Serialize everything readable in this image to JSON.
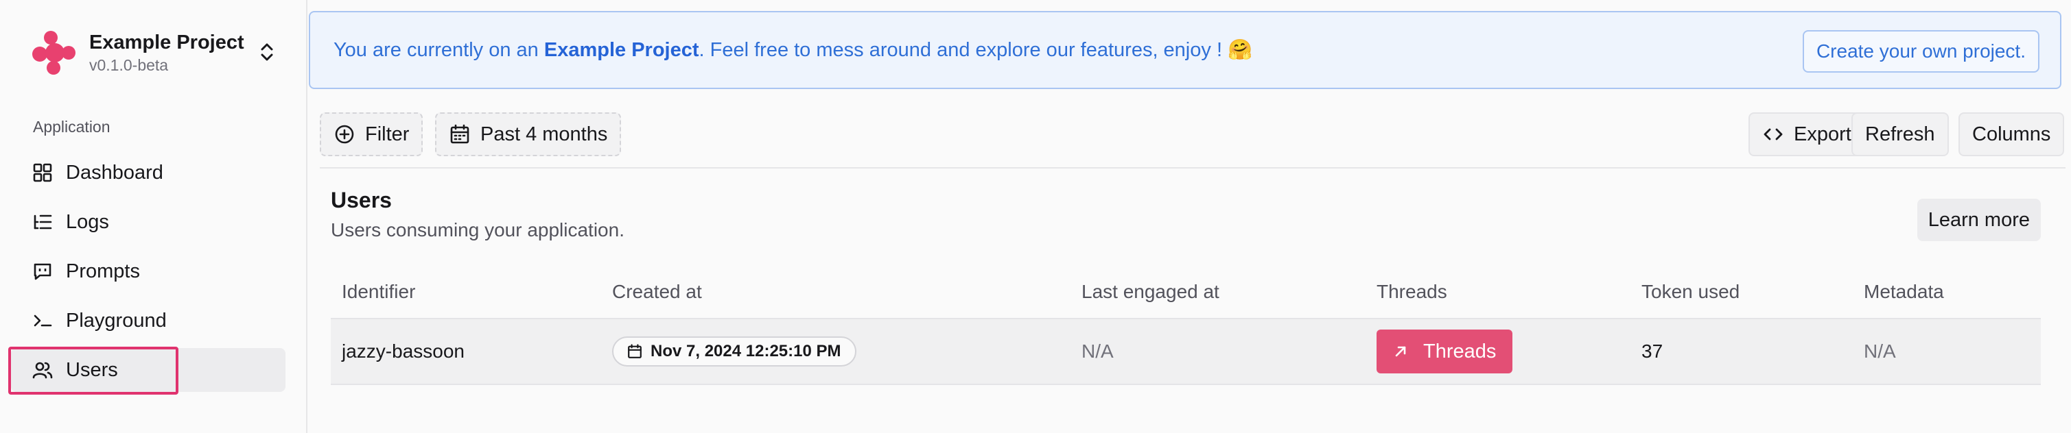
{
  "project": {
    "name": "Example Project",
    "version": "v0.1.0-beta"
  },
  "sidebar": {
    "section_label": "Application",
    "items": [
      {
        "label": "Dashboard",
        "icon": "grid-icon"
      },
      {
        "label": "Logs",
        "icon": "list-tree-icon"
      },
      {
        "label": "Prompts",
        "icon": "message-square-icon"
      },
      {
        "label": "Playground",
        "icon": "terminal-icon"
      },
      {
        "label": "Users",
        "icon": "users-icon",
        "active": true
      }
    ]
  },
  "banner": {
    "prefix": "You are currently on an ",
    "bold": "Example Project",
    "suffix": ". Feel free to mess around and explore our features, enjoy ! 🤗",
    "cta": "Create your own project."
  },
  "toolbar": {
    "filter_label": "Filter",
    "date_range_label": "Past 4 months",
    "export_label": "Export",
    "refresh_label": "Refresh",
    "columns_label": "Columns"
  },
  "card": {
    "title": "Users",
    "subtitle": "Users consuming your application.",
    "learn_more": "Learn more"
  },
  "table": {
    "columns": [
      "Identifier",
      "Created at",
      "Last engaged at",
      "Threads",
      "Token used",
      "Metadata"
    ],
    "rows": [
      {
        "identifier": "jazzy-bassoon",
        "created_at": "Nov 7, 2024 12:25:10 PM",
        "last_engaged": "N/A",
        "threads": "Threads",
        "tokens": "37",
        "metadata": "N/A"
      }
    ]
  },
  "colors": {
    "accent": "#e34f75",
    "banner_text": "#2f6fd6",
    "highlight": "#e0336e"
  }
}
